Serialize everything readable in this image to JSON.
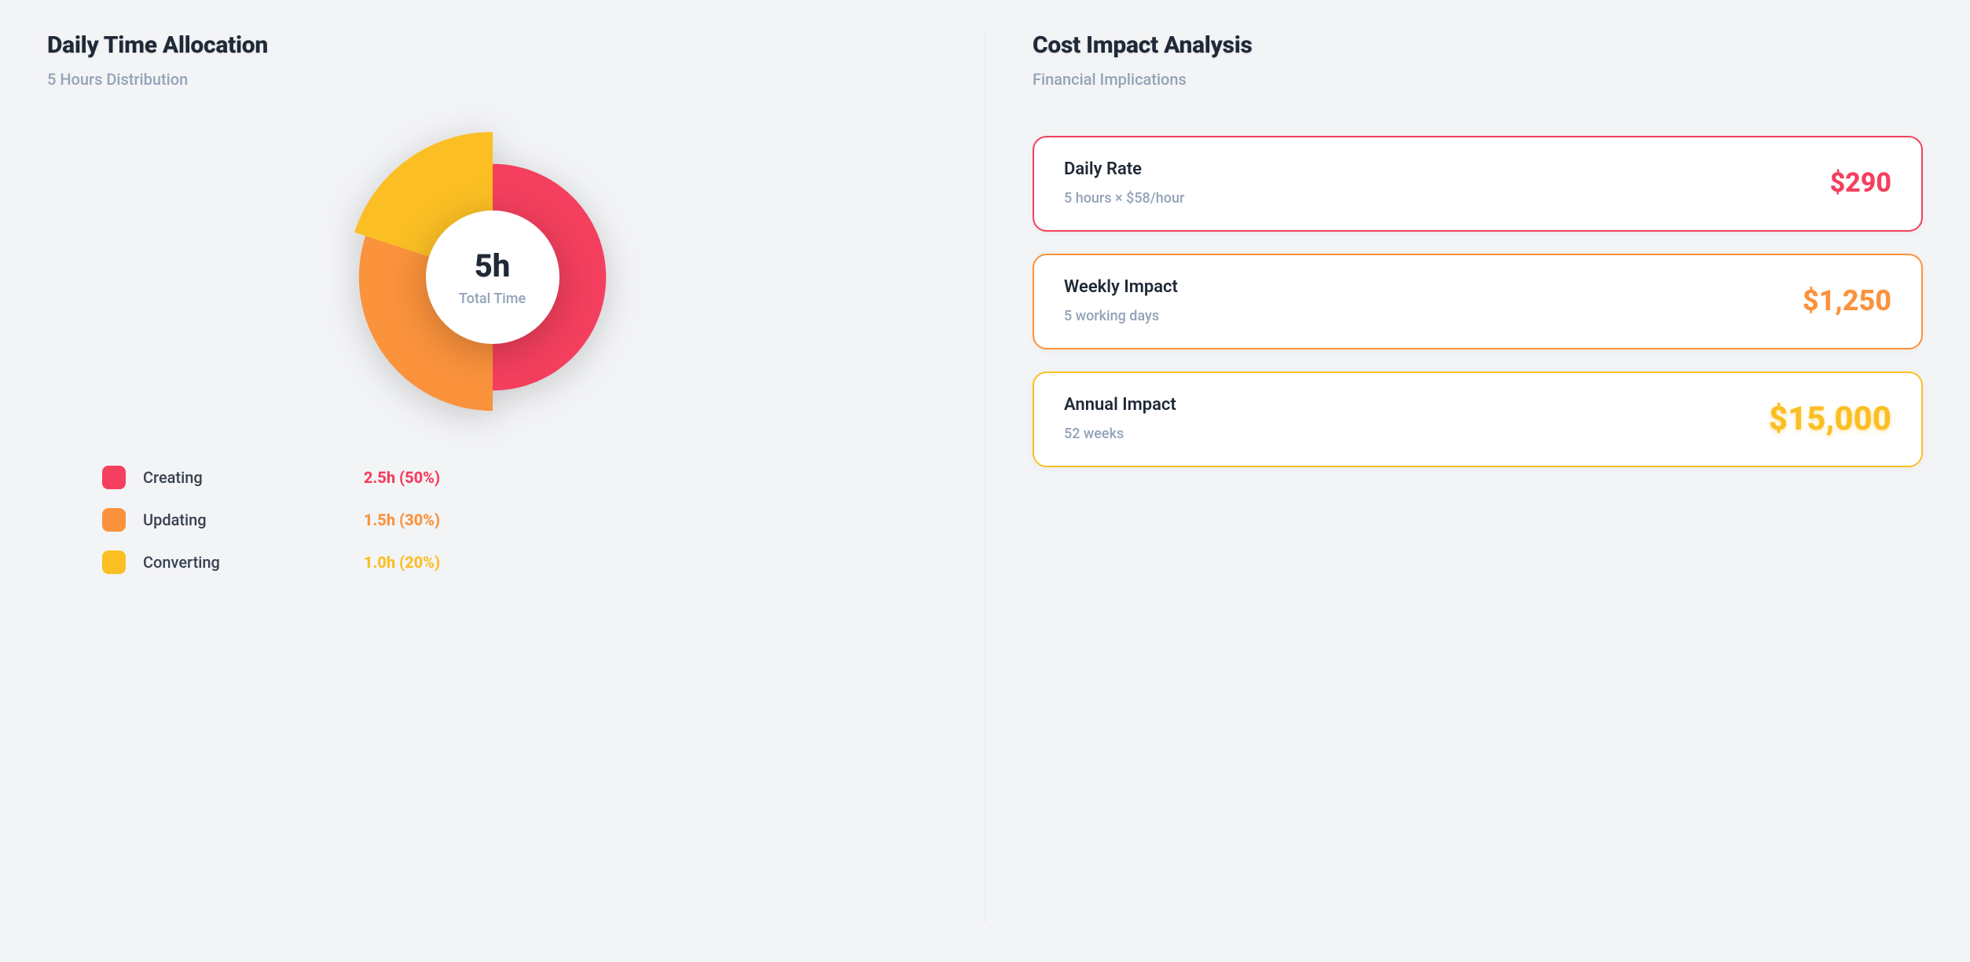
{
  "colors": {
    "red": "#f43f5e",
    "orange": "#fb923c",
    "amber": "#fbbf24"
  },
  "left": {
    "title": "Daily Time Allocation",
    "subtitle": "5 Hours Distribution",
    "center_value": "5h",
    "center_label": "Total Time",
    "legend": [
      {
        "label": "Creating",
        "value": "2.5h (50%)",
        "color_key": "red"
      },
      {
        "label": "Updating",
        "value": "1.5h (30%)",
        "color_key": "orange"
      },
      {
        "label": "Converting",
        "value": "1.0h (20%)",
        "color_key": "amber"
      }
    ]
  },
  "right": {
    "title": "Cost Impact Analysis",
    "subtitle": "Financial Implications",
    "cards": [
      {
        "title": "Daily Rate",
        "sub": "5 hours × $58/hour",
        "amount": "$290",
        "color_key": "red"
      },
      {
        "title": "Weekly Impact",
        "sub": "5 working days",
        "amount": "$1,250",
        "color_key": "orange"
      },
      {
        "title": "Annual Impact",
        "sub": "52 weeks",
        "amount": "$15,000",
        "color_key": "amber"
      }
    ]
  },
  "chart_data": {
    "type": "pie",
    "title": "Daily Time Allocation",
    "subtitle": "5 Hours Distribution",
    "center_label": "5h Total Time",
    "series": [
      {
        "name": "Creating",
        "hours": 2.5,
        "percent": 50,
        "relative_radius": 0.78,
        "color": "#f43f5e"
      },
      {
        "name": "Updating",
        "hours": 1.5,
        "percent": 30,
        "relative_radius": 0.92,
        "color": "#fb923c"
      },
      {
        "name": "Converting",
        "hours": 1.0,
        "percent": 20,
        "relative_radius": 1.0,
        "color": "#fbbf24"
      }
    ],
    "start_angle_deg": 90,
    "direction": "clockwise"
  }
}
